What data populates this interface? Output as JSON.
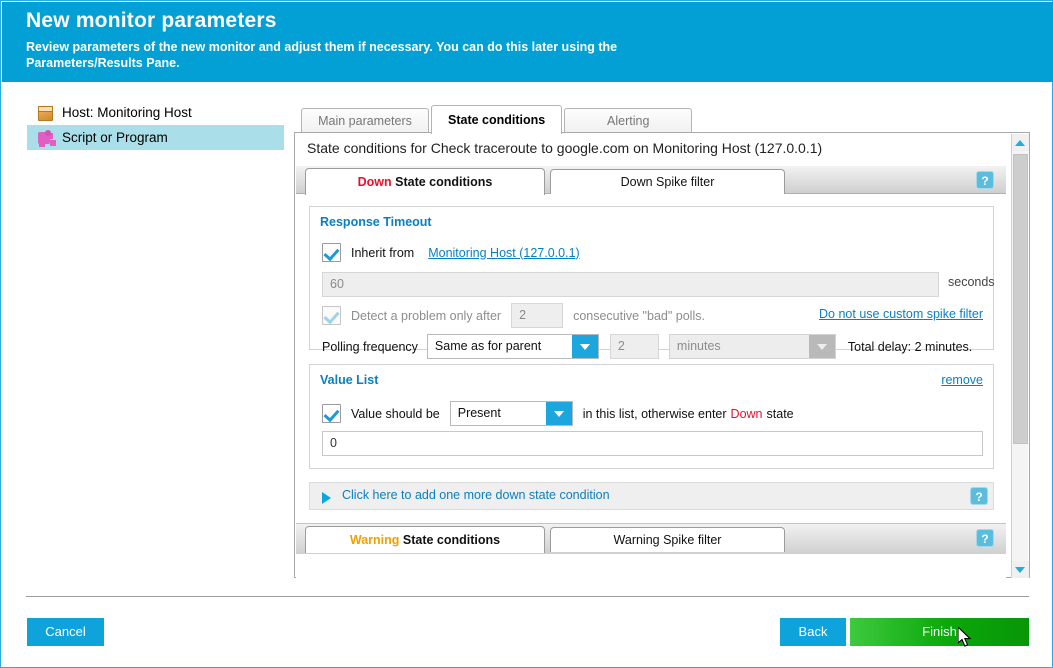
{
  "header": {
    "title": "New monitor parameters",
    "subtitle": "Review parameters of the new monitor and adjust them if necessary. You can do this later using the Parameters/Results Pane."
  },
  "sidebar": {
    "items": [
      {
        "label": "Host: Monitoring Host",
        "icon": "host-box-icon",
        "selected": false
      },
      {
        "label": "Script or Program",
        "icon": "puzzle-piece-icon",
        "selected": true
      }
    ]
  },
  "outer_tabs": [
    {
      "label": "Main parameters",
      "active": false
    },
    {
      "label": "State conditions",
      "active": true
    },
    {
      "label": "Alerting",
      "active": false
    }
  ],
  "panel": {
    "heading": "State conditions for Check traceroute to google.com on Monitoring Host (127.0.0.1)",
    "inner_tabs": [
      {
        "label_accent": "Down",
        "label": "State conditions",
        "active": true
      },
      {
        "label_accent": "",
        "label": "Down Spike filter",
        "active": false
      }
    ],
    "help_label": "?",
    "response_timeout": {
      "title": "Response Timeout",
      "inherit_label": "Inherit from",
      "inherit_link": "Monitoring Host (127.0.0.1)",
      "inherit_checked": true,
      "timeout_value": "60",
      "timeout_unit": "seconds",
      "detect_checked": true,
      "detect_prefix": "Detect a problem only after",
      "detect_count": "2",
      "detect_suffix": "consecutive \"bad\" polls.",
      "spike_filter_link": "Do not use custom spike filter",
      "polling_label": "Polling frequency",
      "polling_mode": "Same as for parent",
      "polling_interval": "2",
      "polling_unit": "minutes",
      "total_delay": "Total delay: 2 minutes."
    },
    "value_list": {
      "title": "Value List",
      "remove_link": "remove",
      "checked": true,
      "prefix": "Value should be",
      "presence": "Present",
      "middle": "in this list, otherwise enter",
      "state_accent": "Down",
      "suffix": "state",
      "list_value": "0"
    },
    "add_condition": {
      "label": "Click here to add one more down state condition"
    },
    "warning_tabs": [
      {
        "label_accent": "Warning",
        "label": "State conditions",
        "active": true
      },
      {
        "label_accent": "",
        "label": "Warning Spike filter",
        "active": false
      }
    ]
  },
  "footer": {
    "cancel": "Cancel",
    "back": "Back",
    "finish": "Finish"
  },
  "colors": {
    "header_blue": "#02a0d4",
    "accent_blue": "#0a7fc2",
    "down_red": "#e8102a",
    "warning_orange": "#f0a000",
    "finish_green": "#0aa80a",
    "selected_sidebar": "#aadfe9"
  }
}
